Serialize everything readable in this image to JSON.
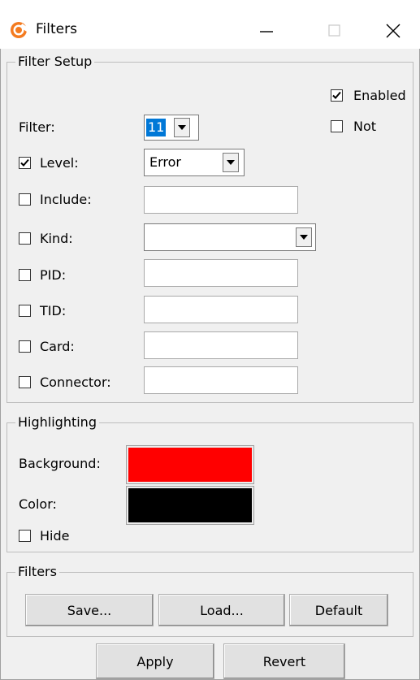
{
  "window": {
    "title": "Filters",
    "icon": "app-logo-icon",
    "controls": [
      "minimize-icon",
      "maximize-icon",
      "close-icon"
    ]
  },
  "filter_setup": {
    "group_title": "Filter Setup",
    "enabled": {
      "label": "Enabled",
      "checked": true
    },
    "not": {
      "label": "Not",
      "checked": false
    },
    "filter": {
      "label": "Filter:",
      "value": "11"
    },
    "level": {
      "label": "Level:",
      "checked": true,
      "value": "Error"
    },
    "include": {
      "label": "Include:",
      "checked": false,
      "value": ""
    },
    "kind": {
      "label": "Kind:",
      "checked": false,
      "value": ""
    },
    "pid": {
      "label": "PID:",
      "checked": false,
      "value": ""
    },
    "tid": {
      "label": "TID:",
      "checked": false,
      "value": ""
    },
    "card": {
      "label": "Card:",
      "checked": false,
      "value": ""
    },
    "connector": {
      "label": "Connector:",
      "checked": false,
      "value": ""
    }
  },
  "highlighting": {
    "group_title": "Highlighting",
    "background": {
      "label": "Background:",
      "color": "#ff0000"
    },
    "color": {
      "label": "Color:",
      "color": "#000000"
    },
    "hide": {
      "label": "Hide",
      "checked": false
    }
  },
  "filters_group": {
    "group_title": "Filters",
    "save_label": "Save...",
    "load_label": "Load...",
    "default_label": "Default"
  },
  "footer": {
    "apply_label": "Apply",
    "revert_label": "Revert"
  },
  "colors": {
    "selection": "#0078d7",
    "window_bg": "#f0f0f0"
  }
}
